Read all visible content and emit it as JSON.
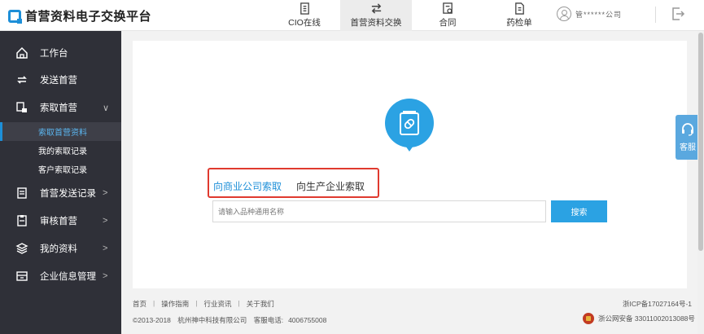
{
  "app": {
    "title": "首营资料电子交换平台"
  },
  "topnav": [
    {
      "label": "CIO在线",
      "icon": "cio-online-icon"
    },
    {
      "label": "首营资料交换",
      "icon": "exchange-arrows-icon",
      "active": true
    },
    {
      "label": "合同",
      "icon": "contract-icon"
    },
    {
      "label": "药检单",
      "icon": "drug-report-icon"
    }
  ],
  "user": {
    "name": "管******公司"
  },
  "sidebar": {
    "items": [
      {
        "label": "工作台",
        "icon": "home-icon"
      },
      {
        "label": "发送首营",
        "icon": "send-loop-icon"
      },
      {
        "label": "索取首营",
        "icon": "request-hand-icon",
        "chevron": "∨"
      },
      {
        "label": "首营发送记录",
        "icon": "send-record-icon",
        "chevron": ">"
      },
      {
        "label": "审核首营",
        "icon": "audit-icon",
        "chevron": ">"
      },
      {
        "label": "我的资料",
        "icon": "layers-icon",
        "chevron": ">"
      },
      {
        "label": "企业信息管理",
        "icon": "company-icon",
        "chevron": ">"
      }
    ],
    "sub_items": [
      {
        "label": "索取首营资料",
        "active": true
      },
      {
        "label": "我的索取记录"
      },
      {
        "label": "客户索取记录"
      }
    ]
  },
  "main": {
    "tabs": [
      {
        "label": "向商业公司索取",
        "active": true
      },
      {
        "label": "向生产企业索取"
      }
    ],
    "search": {
      "placeholder": "请输入品种通用名称",
      "button": "搜索"
    }
  },
  "footer": {
    "links": [
      "首页",
      "操作指南",
      "行业资讯",
      "关于我们"
    ],
    "separator": "|",
    "copyright": "©2013-2018",
    "company": "杭州神中科技有限公司",
    "phone_label": "客服电话:",
    "phone": "4006755008",
    "icp": "浙ICP备17027164号-1",
    "police_record": "浙公网安备 33011002013088号"
  },
  "service": {
    "label": "客服"
  },
  "colors": {
    "accent": "#1d8fd8",
    "sidebar_bg": "#2f3038",
    "highlight_border": "#e03a2f"
  }
}
